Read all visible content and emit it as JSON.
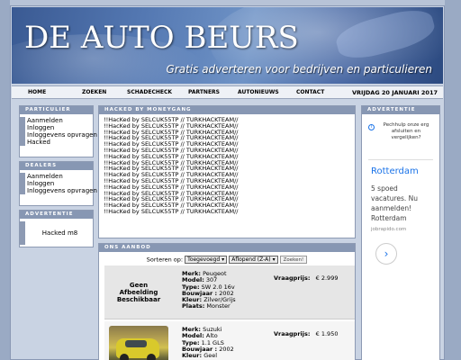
{
  "header": {
    "title": "DE AUTO BEURS",
    "tagline": "Gratis adverteren voor bedrijven en particulieren"
  },
  "nav": {
    "items": [
      "HOME",
      "ZOEKEN",
      "SCHADECHECK",
      "PARTNERS",
      "AUTONIEUWS",
      "CONTACT"
    ],
    "date": "VRIJDAG 20 JANUARI 2017"
  },
  "particulier": {
    "heading": "PARTICULIER",
    "links": [
      "Aanmelden",
      "Inloggen",
      "Inloggevens opvragen",
      "Hacked"
    ]
  },
  "dealers": {
    "heading": "DEALERS",
    "links": [
      "Aanmelden",
      "Inloggen",
      "Inloggevens opvragen"
    ]
  },
  "advertentie_left": {
    "heading": "ADVERTENTIE",
    "text": "Hacked m8"
  },
  "hacked": {
    "heading": "HACKED BY MONEYGANG",
    "line": "!!HacKed by SELCUK55TP // TURKHACKTEAM//",
    "count": 16
  },
  "aanbod": {
    "heading": "ONS AANBOD",
    "sort_label": "Sorteren op:",
    "sort_value": "Toegevoegd",
    "order_value": "Aflopend (Z-A)",
    "search_button": "Zoeken!",
    "listings": [
      {
        "image_text": "Geen Afbeelding Beschikbaar",
        "merk_label": "Merk:",
        "merk": "Peugeot",
        "model_label": "Model:",
        "model": "307",
        "type_label": "Type:",
        "type": "SW 2.0 16v",
        "bouwjaar_label": "Bouwjaar :",
        "bouwjaar": "2002",
        "kleur_label": "Kleur:",
        "kleur": "Zilver/Grijs",
        "plaats_label": "Plaats:",
        "plaats": "Monster",
        "price_label": "Vraagprijs:",
        "price": "€  2.999"
      },
      {
        "image_text": "",
        "merk_label": "Merk:",
        "merk": "Suzuki",
        "model_label": "Model:",
        "model": "Alto",
        "type_label": "Type:",
        "type": "1.1 GLS",
        "bouwjaar_label": "Bouwjaar :",
        "bouwjaar": "2002",
        "kleur_label": "Kleur:",
        "kleur": "Geel",
        "price_label": "Vraagprijs:",
        "price": "€  1.950"
      }
    ]
  },
  "advertentie_right": {
    "heading": "ADVERTENTIE",
    "notice": "Pechhulp onze erg afsluiten en vergelijken?",
    "city": "Rotterdam",
    "body": "5 spoed vacatures. Nu aanmelden! Rotterdam",
    "source": "jobrapido.com"
  },
  "colors": {
    "box_header": "#8797b3",
    "page_bg": "#c9d3e3",
    "ad_link": "#1a73e8"
  }
}
